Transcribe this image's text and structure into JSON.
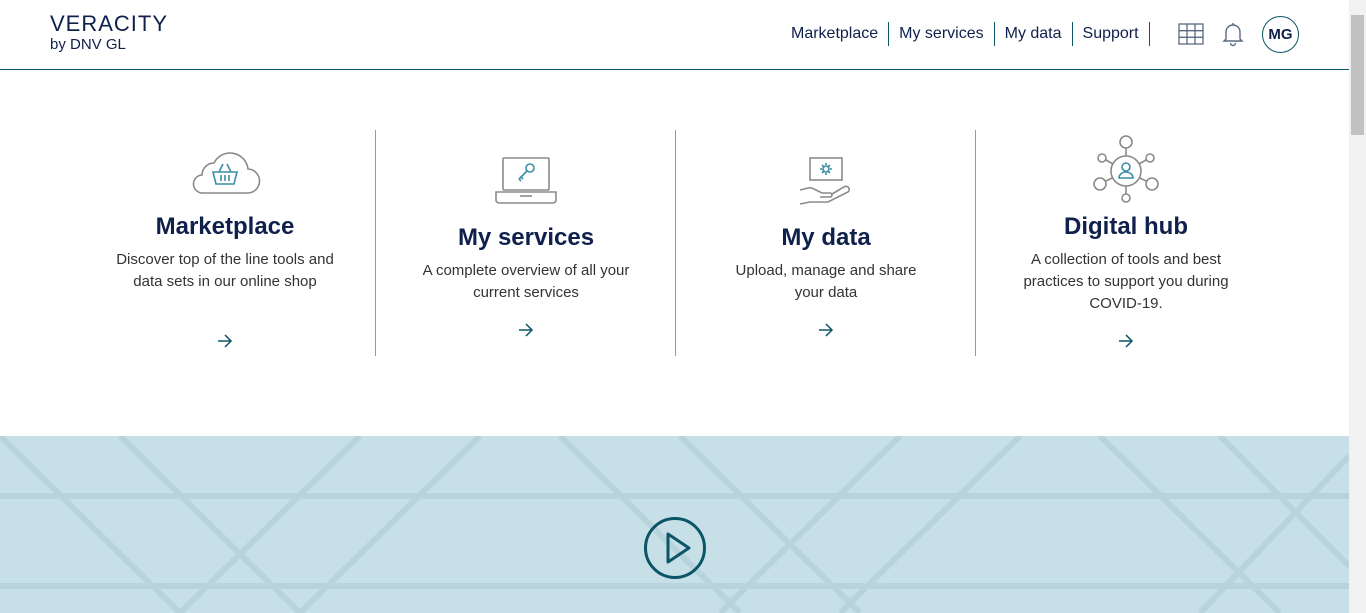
{
  "header": {
    "logo_main": "VERACITY",
    "logo_sub": "by DNV GL",
    "nav": [
      "Marketplace",
      "My services",
      "My data",
      "Support"
    ],
    "avatar": "MG",
    "icons": [
      "apps-grid-icon",
      "bell-icon"
    ]
  },
  "cards": [
    {
      "title": "Marketplace",
      "desc": "Discover top of the line tools and data sets in our online shop",
      "icon": "cloud-basket-icon"
    },
    {
      "title": "My services",
      "desc": "A complete overview of all your current services",
      "icon": "laptop-key-icon"
    },
    {
      "title": "My data",
      "desc": "Upload, manage and share your data",
      "icon": "hand-data-icon"
    },
    {
      "title": "Digital hub",
      "desc": "A collection of tools and best practices to support you during COVID-19.",
      "icon": "network-user-icon"
    }
  ],
  "hero": {
    "icon": "play-icon"
  },
  "colors": {
    "primary": "#0f204b",
    "accent": "#0b5566",
    "icon_gray": "#8a8a8a",
    "hero_bg": "#c7dfe6"
  }
}
